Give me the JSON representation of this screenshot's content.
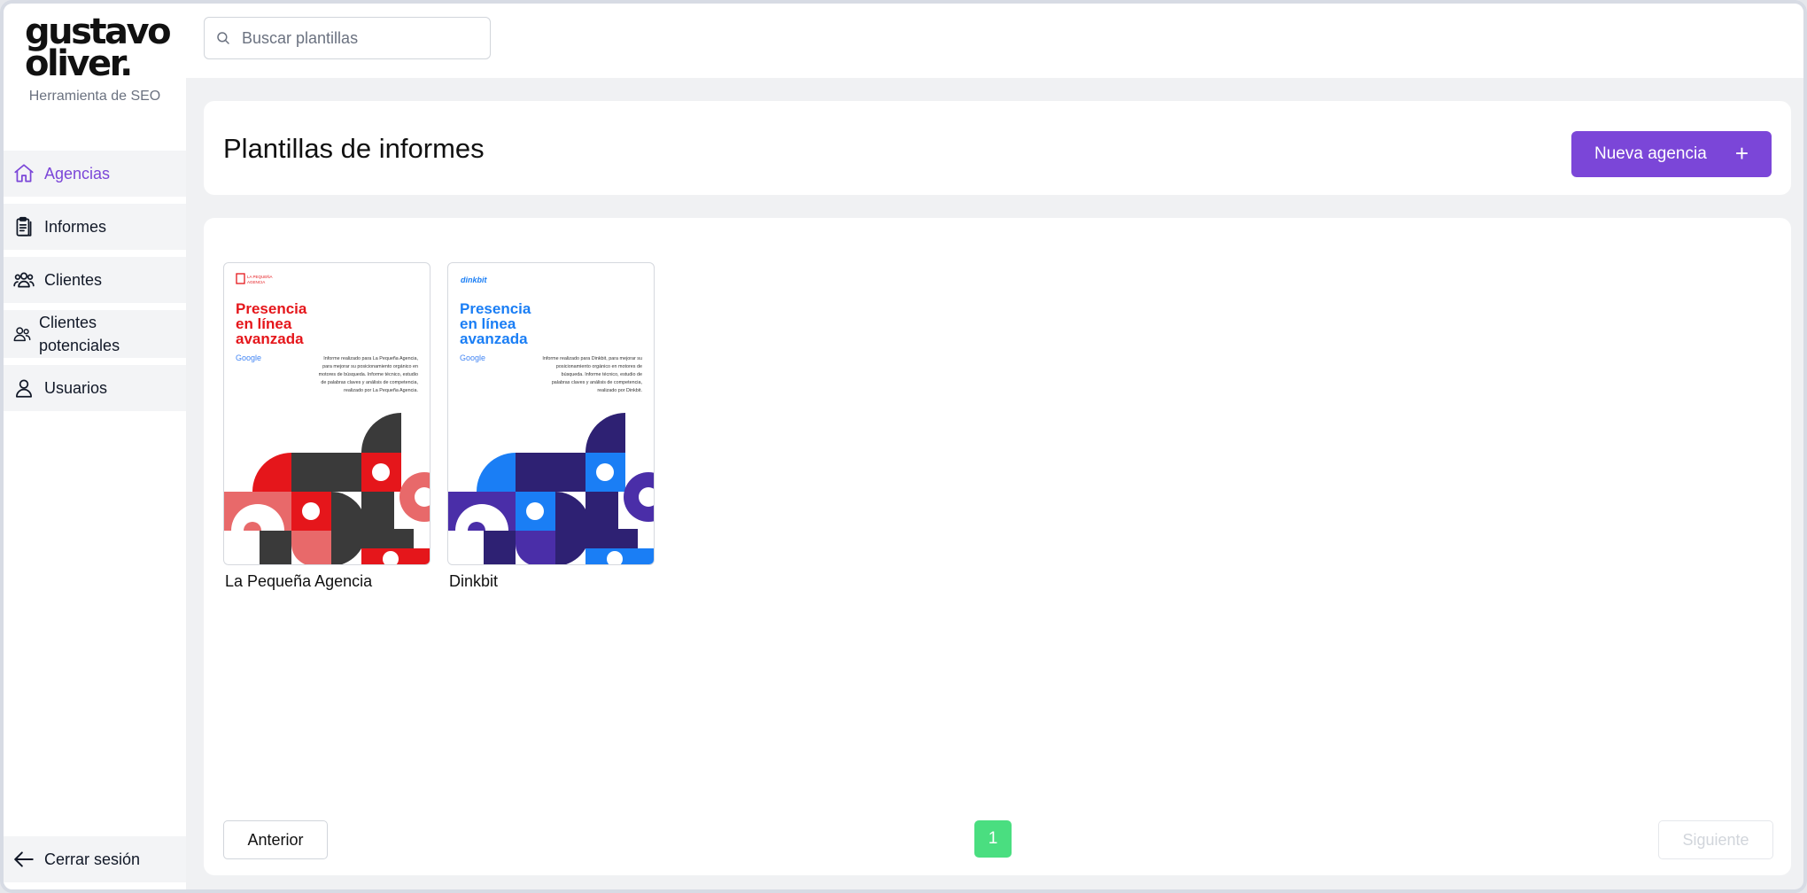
{
  "brand": {
    "logo_line1": "gustavo",
    "logo_line2": "oliver.",
    "tagline": "Herramienta de SEO"
  },
  "nav": {
    "items": [
      {
        "label": "Agencias",
        "icon": "home-icon",
        "active": true
      },
      {
        "label": "Informes",
        "icon": "clipboard-icon",
        "active": false
      },
      {
        "label": "Clientes",
        "icon": "users-icon",
        "active": false
      },
      {
        "label_line1": "Clientes",
        "label_line2": "potenciales",
        "icon": "user-group-icon",
        "active": false
      },
      {
        "label": "Usuarios",
        "icon": "user-icon",
        "active": false
      }
    ],
    "logout": "Cerrar sesión"
  },
  "search": {
    "placeholder": "Buscar plantillas",
    "value": ""
  },
  "header": {
    "title": "Plantillas de informes",
    "new_button": "Nueva agencia",
    "new_button_icon": "plus-icon"
  },
  "templates": [
    {
      "name": "La Pequeña Agencia",
      "accent": "#e5161b",
      "dark": "#3a3a3a",
      "light": "#e8696a",
      "heading_lines": [
        "Presencia",
        "en línea",
        "avanzada"
      ],
      "google": "Google",
      "body_lines": [
        "Informe realizado para La Pequeña Agencia,",
        "para mejorar su posicionamiento orgánico en",
        "motores de búsqueda. Informe técnico, estudio",
        "de palabras claves y análisis de competencia,",
        "realizado por La Pequeña Agencia."
      ]
    },
    {
      "name": "Dinkbit",
      "accent": "#1a7ef5",
      "dark": "#2e2173",
      "light": "#4a2ea8",
      "logo_text": "dinkbit",
      "heading_lines": [
        "Presencia",
        "en línea",
        "avanzada"
      ],
      "google": "Google",
      "body_lines": [
        "Informe realizado para Dinkbit, para mejorar su",
        "posicionamiento orgánico en motores de",
        "búsqueda. Informe técnico, estudio de",
        "palabras claves y análisis de competencia,",
        "realizado por Dinkbit."
      ]
    }
  ],
  "pagination": {
    "prev": "Anterior",
    "current": "1",
    "next": "Siguiente"
  },
  "colors": {
    "primary": "#7b46d8",
    "page_active": "#4ade80"
  }
}
